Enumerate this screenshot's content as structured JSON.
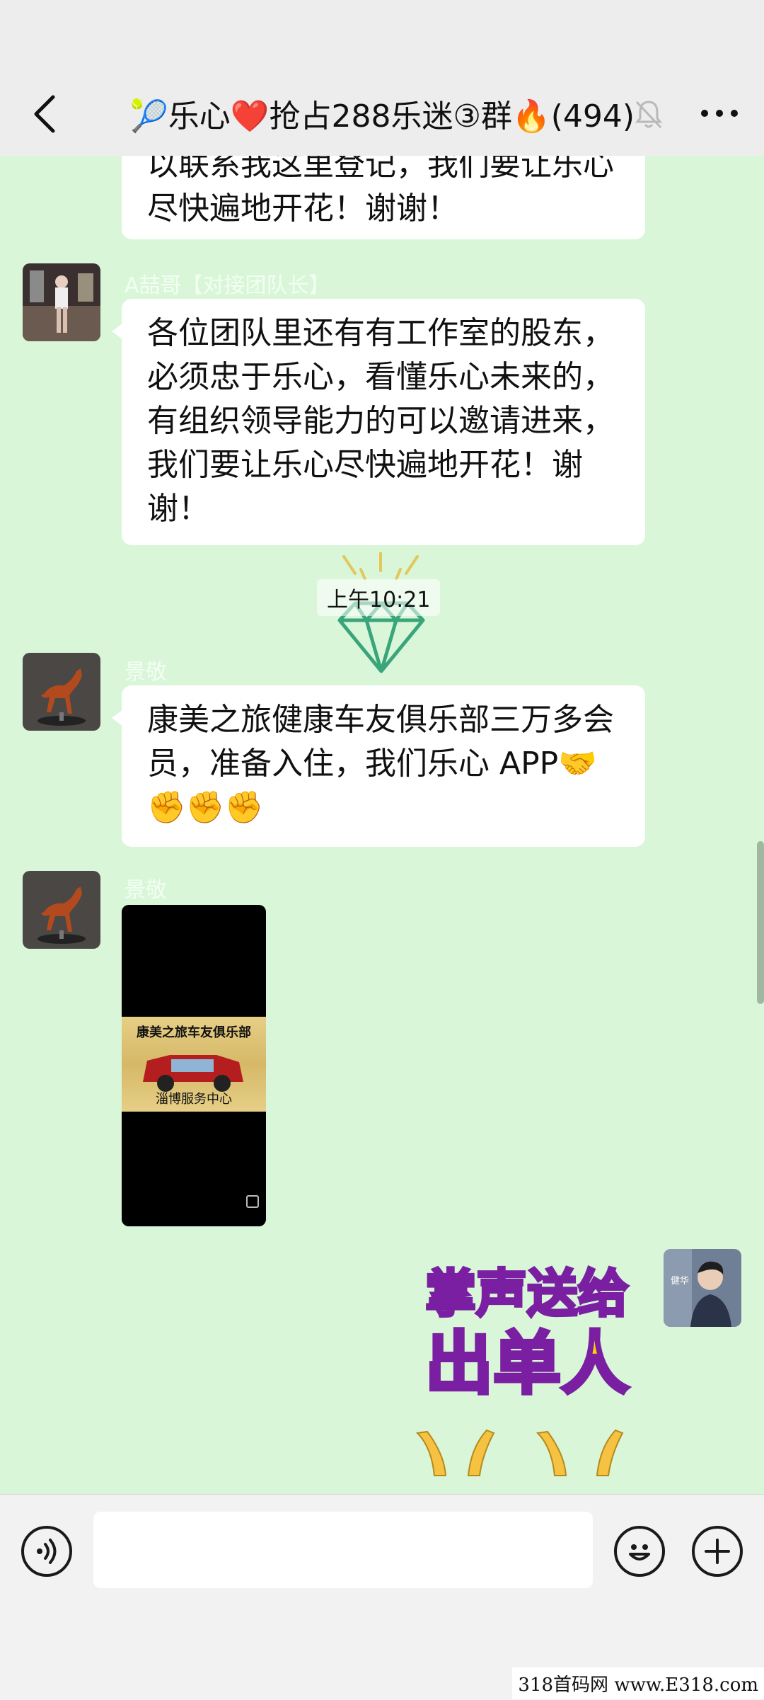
{
  "header": {
    "title": "🎾乐心❤️抢占288乐迷③群🔥(494)"
  },
  "messages": {
    "m0": {
      "line1": "以联系我这里登记，我们要让乐心",
      "line2": "尽快遍地开花！谢谢！"
    },
    "m1": {
      "sender": "A喆哥【对接团队长】",
      "line1": "各位团队里还有有工作室的股东，",
      "line2": "必须忠于乐心，看懂乐心未来的，",
      "line3": "有组织领导能力的可以邀请进来，",
      "line4": "我们要让乐心尽快遍地开花！谢",
      "line5": "谢！"
    },
    "timestamp": "上午10:21",
    "m2": {
      "sender": "景敬",
      "line1": "康美之旅健康车友俱乐部三万多会",
      "line2": "员，准备入住，我们乐心 APP🤝",
      "line3": "✊✊✊"
    },
    "m3": {
      "sender": "景敬",
      "image_arc_text": "康美之旅车友俱乐部",
      "image_caption": "淄博服务中心"
    },
    "m4": {
      "sticker_line1": "掌声送给",
      "sticker_line2": "出单人",
      "avatar_text": "健华"
    }
  },
  "input": {
    "placeholder": ""
  },
  "watermark": "318首码网  www.E318.com",
  "colors": {
    "chat_bg": "#d9f6d9",
    "bubble": "#ffffff",
    "nav_bg": "#ededed",
    "sticker_yellow": "#ffd400",
    "sticker_outline": "#7a1fa2"
  }
}
